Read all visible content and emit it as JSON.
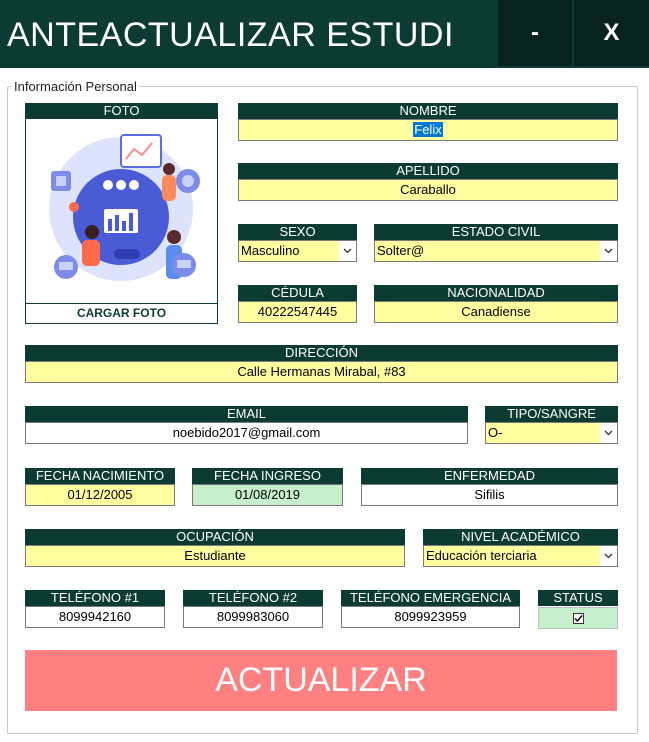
{
  "window": {
    "title": "ANTEACTUALIZAR ESTUDI",
    "minimize_label": "-",
    "close_label": "X"
  },
  "frame": {
    "legend": "Información Personal"
  },
  "photo": {
    "header": "FOTO",
    "button": "CARGAR FOTO"
  },
  "nombre": {
    "label": "NOMBRE",
    "value": "Felix"
  },
  "apellido": {
    "label": "APELLIDO",
    "value": "Caraballo"
  },
  "sexo": {
    "label": "SEXO",
    "value": "Masculino"
  },
  "estado_civil": {
    "label": "ESTADO CIVIL",
    "value": "Solter@"
  },
  "cedula": {
    "label": "CÉDULA",
    "value": "40222547445"
  },
  "nacionalidad": {
    "label": "NACIONALIDAD",
    "value": "Canadiense"
  },
  "direccion": {
    "label": "DIRECCIÓN",
    "value": "Calle Hermanas Mirabal, #83"
  },
  "email": {
    "label": "EMAIL",
    "value": "noebido2017@gmail.com"
  },
  "tipo_sangre": {
    "label": "TIPO/SANGRE",
    "value": "O-"
  },
  "fecha_nacimiento": {
    "label": "FECHA NACIMIENTO",
    "value": "01/12/2005"
  },
  "fecha_ingreso": {
    "label": "FECHA INGRESO",
    "value": "01/08/2019"
  },
  "enfermedad": {
    "label": "ENFERMEDAD",
    "value": "Sifilis"
  },
  "ocupacion": {
    "label": "OCUPACIÓN",
    "value": "Estudiante"
  },
  "nivel_academico": {
    "label": "NIVEL ACADÉMICO",
    "value": "Educación terciaria"
  },
  "telefono1": {
    "label": "TELÉFONO #1",
    "value": "8099942160"
  },
  "telefono2": {
    "label": "TELÉFONO #2",
    "value": "8099983060"
  },
  "telefono_emergencia": {
    "label": "TELÉFONO EMERGENCIA",
    "value": "8099923959"
  },
  "status": {
    "label": "STATUS",
    "checked": true
  },
  "actions": {
    "update_label": "ACTUALIZAR"
  },
  "icons": {
    "dropdown": "chevron-down-icon",
    "checkbox": "checkmark-icon",
    "photo": "people-technology-illustration"
  },
  "colors": {
    "header_bg": "#0c3b33",
    "field_yellow": "#ffffa0",
    "field_green": "#c6efce",
    "update_button": "#ff8080"
  }
}
